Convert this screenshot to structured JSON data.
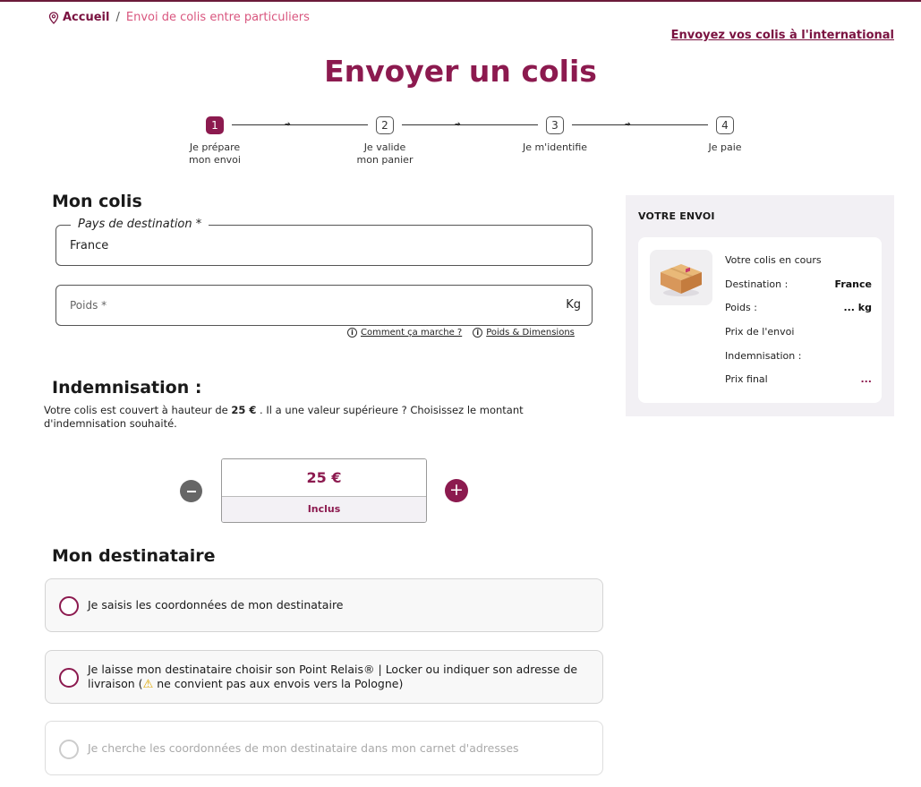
{
  "breadcrumb": {
    "home": "Accueil",
    "separator": "/",
    "current": "Envoi de colis entre particuliers"
  },
  "header": {
    "international_link": "Envoyez vos colis à l'international"
  },
  "page": {
    "title": "Envoyer un colis"
  },
  "stepper": {
    "steps": [
      {
        "number": "1",
        "label": "Je prépare\nmon envoi",
        "active": true
      },
      {
        "number": "2",
        "label": "Je valide\nmon panier",
        "active": false
      },
      {
        "number": "3",
        "label": "Je m'identifie",
        "active": false
      },
      {
        "number": "4",
        "label": "Je paie",
        "active": false
      }
    ]
  },
  "colis": {
    "title": "Mon colis",
    "destination": {
      "label": "Pays de destination *",
      "value": "France"
    },
    "weight": {
      "placeholder": "Poids *",
      "unit": "Kg"
    },
    "help": {
      "how_it_works": "Comment ça marche ?",
      "weight_dimensions": "Poids & Dimensions"
    }
  },
  "indemnisation": {
    "title": "Indemnisation :",
    "text_before": "Votre colis est couvert à hauteur de ",
    "amount_bold": "25 €",
    "text_after": " . Il a une valeur supérieure ? Choisissez le montant d'indemnisation souhaité.",
    "selected_amount": "25 €",
    "status": "Inclus",
    "plus": "+"
  },
  "destinataire": {
    "title": "Mon destinataire",
    "options": [
      {
        "label": "Je saisis les coordonnées de mon destinataire"
      },
      {
        "label_before": "Je laisse mon destinataire choisir son Point Relais® | Locker ou indiquer son adresse de livraison (",
        "warning": "⚠",
        "label_after": " ne convient pas aux envois vers la Pologne)"
      },
      {
        "label": "Je cherche les coordonnées de mon destinataire dans mon carnet d'adresses"
      }
    ]
  },
  "summary": {
    "title": "VOTRE ENVOI",
    "current": "Votre colis en cours",
    "destination_label": "Destination :",
    "destination_value": "France",
    "weight_label": "Poids :",
    "weight_value": "... kg",
    "price_label": "Prix de l'envoi",
    "indem_label": "Indemnisation :",
    "final_label": "Prix final",
    "final_value": "..."
  },
  "colors": {
    "brand": "#8c1a4f",
    "breadcrumb_current": "#d9567f",
    "summary_bg": "#f2f0f4"
  }
}
